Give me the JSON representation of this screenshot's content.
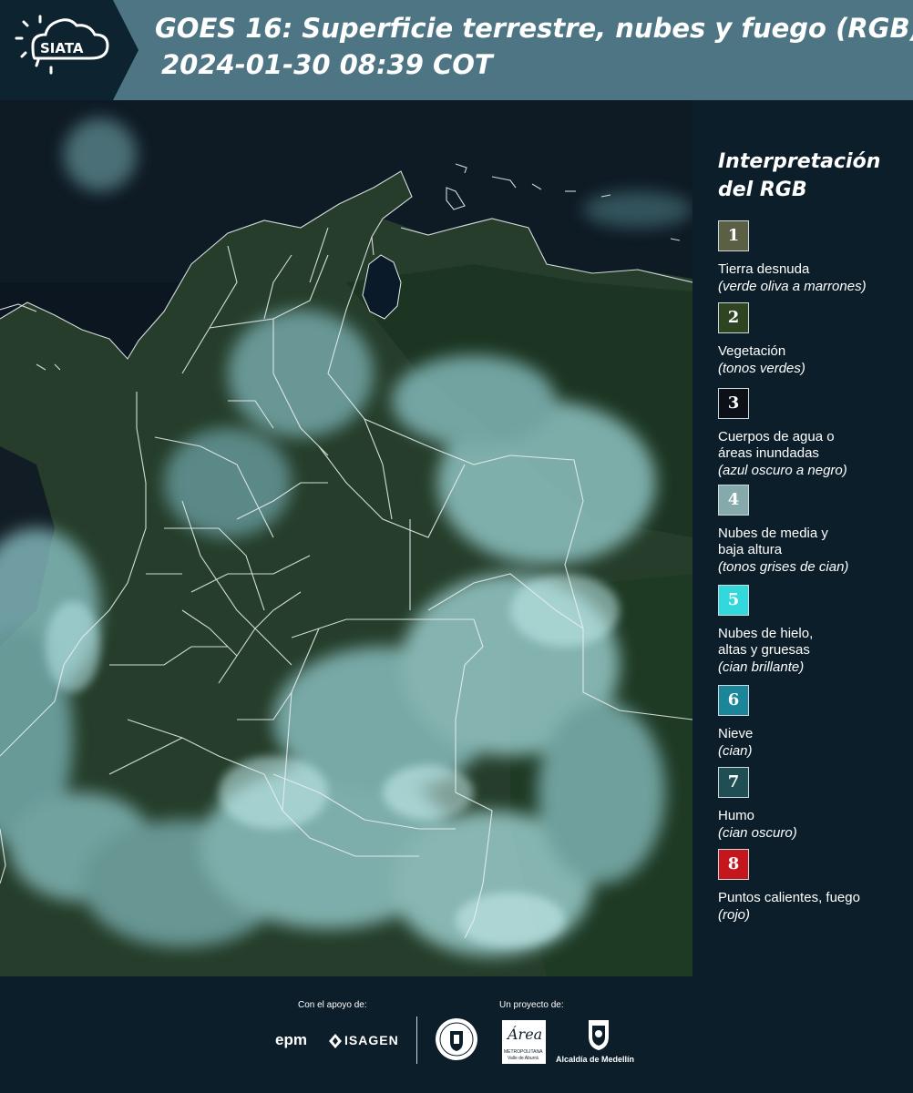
{
  "header": {
    "logo_text": "SIATA",
    "title_line1": "GOES 16: Superficie terrestre, nubes y fuego (RGB)",
    "title_line2": "2024-01-30 08:39 COT"
  },
  "legend": {
    "title": "Interpretación del RGB",
    "items": [
      {
        "number": "1",
        "label": "Tierra desnuda",
        "desc": "(verde oliva a marrones)",
        "color": "#5b5f44"
      },
      {
        "number": "2",
        "label": "Vegetación",
        "desc": "(tonos verdes)",
        "color": "#2f4522"
      },
      {
        "number": "3",
        "label": "Cuerpos de agua o\náreas inundadas",
        "desc": "(azul oscuro a negro)",
        "color": "#0b1117"
      },
      {
        "number": "4",
        "label": "Nubes de media y\nbaja altura",
        "desc": "(tonos grises de cian)",
        "color": "#86a9ab"
      },
      {
        "number": "5",
        "label": "Nubes de hielo,\naltas y gruesas",
        "desc": "(cian brillante)",
        "color": "#31d9dd"
      },
      {
        "number": "6",
        "label": "Nieve",
        "desc": "(cian)",
        "color": "#1b869a"
      },
      {
        "number": "7",
        "label": "Humo",
        "desc": "(cian oscuro)",
        "color": "#1f4f55"
      },
      {
        "number": "8",
        "label": "Puntos calientes, fuego",
        "desc": "(rojo)",
        "color": "#c4161c"
      }
    ]
  },
  "footer": {
    "support_label": "Con el apoyo de:",
    "project_label": "Un proyecto de:",
    "epm_text": "epm",
    "isagen_text": "ISAGEN",
    "area_text": "Área",
    "area_sub1": "METROPOLITANA",
    "area_sub2": "Valle de Aburrá",
    "alcaldia_text": "Alcaldía de Medellín"
  },
  "colors": {
    "header_bg": "#4e7583",
    "page_bg": "#0c1e29",
    "border_lines": "#e8eef0"
  }
}
